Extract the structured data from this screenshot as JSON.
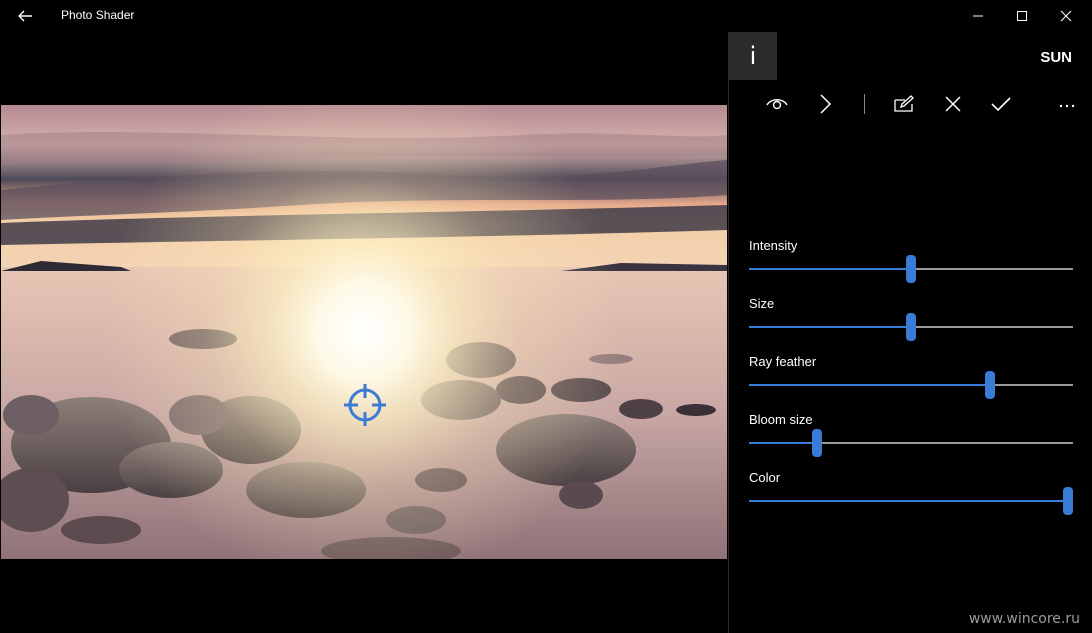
{
  "app": {
    "title": "Photo Shader"
  },
  "panel": {
    "info_label": "i",
    "effect_name": "SUN",
    "toolbar": [
      {
        "name": "preview-button",
        "icon": "eye-icon"
      },
      {
        "name": "next-button",
        "icon": "chevron-right-icon"
      },
      {
        "name": "edit-button",
        "icon": "pen-icon"
      },
      {
        "name": "cancel-button",
        "icon": "close-icon"
      },
      {
        "name": "apply-button",
        "icon": "check-icon"
      },
      {
        "name": "more-button",
        "icon": "more-icon"
      }
    ],
    "sliders": [
      {
        "label": "Intensity",
        "value": 0.5
      },
      {
        "label": "Size",
        "value": 0.5
      },
      {
        "label": "Ray feather",
        "value": 0.745
      },
      {
        "label": "Bloom size",
        "value": 0.21
      },
      {
        "label": "Color",
        "value": 0.985
      }
    ]
  },
  "colors": {
    "accent": "#3a7bd5",
    "panel_bg": "#000000",
    "info_bg": "#2b2b2b"
  },
  "watermark": "www.wincore.ru"
}
